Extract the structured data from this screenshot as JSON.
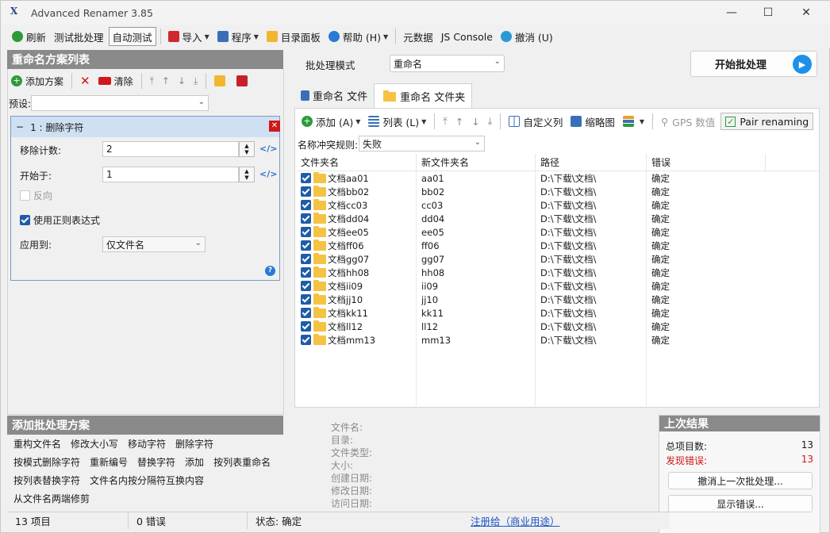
{
  "window": {
    "title": "Advanced Renamer 3.85"
  },
  "menu": [
    {
      "label": "刷新",
      "icon": "refresh-icon"
    },
    {
      "label": "测试批处理",
      "icon": ""
    },
    {
      "label": "自动测试",
      "icon": "",
      "active": true
    },
    {
      "label": "导入",
      "icon": "import-icon",
      "dropdown": true
    },
    {
      "label": "程序",
      "icon": "program-icon",
      "dropdown": true
    },
    {
      "label": "目录面板",
      "icon": "folder-icon"
    },
    {
      "label": "帮助 (H)",
      "icon": "help-icon",
      "dropdown": true
    },
    {
      "label": "元数据",
      "icon": ""
    },
    {
      "label": "JS Console",
      "icon": ""
    },
    {
      "label": "撤消 (U)",
      "icon": "undo-icon"
    }
  ],
  "left": {
    "header": "重命名方案列表",
    "add_method": "添加方案",
    "clear": "清除",
    "preset_label": "预设:",
    "rule": {
      "title": "1 : 删除字符",
      "fields": [
        {
          "label": "移除计数:",
          "value": "2"
        },
        {
          "label": "开始于:",
          "value": "1"
        }
      ],
      "reverse_label": "反向",
      "regex_label": "使用正则表达式",
      "apply_label": "应用到:",
      "apply_value": "仅文件名"
    }
  },
  "batch": {
    "mode_label": "批处理模式",
    "mode_value": "重命名",
    "start_button": "开始批处理"
  },
  "tabs": [
    {
      "label": "重命名 文件"
    },
    {
      "label": "重命名 文件夹"
    }
  ],
  "list_toolbar": {
    "add": "添加 (A)",
    "list": "列表 (L)",
    "custom_columns": "自定义列",
    "thumbnails": "缩略图",
    "gps": "GPS 数值",
    "pair_renaming": "Pair renaming"
  },
  "conflict": {
    "label": "名称冲突规则:",
    "value": "失败"
  },
  "columns": [
    "文件夹名",
    "新文件夹名",
    "路径",
    "错误"
  ],
  "rows": [
    {
      "name": "文档aa01",
      "new": "aa01",
      "path": "D:\\下载\\文档\\",
      "status": "确定"
    },
    {
      "name": "文档bb02",
      "new": "bb02",
      "path": "D:\\下载\\文档\\",
      "status": "确定"
    },
    {
      "name": "文档cc03",
      "new": "cc03",
      "path": "D:\\下载\\文档\\",
      "status": "确定"
    },
    {
      "name": "文档dd04",
      "new": "dd04",
      "path": "D:\\下载\\文档\\",
      "status": "确定"
    },
    {
      "name": "文档ee05",
      "new": "ee05",
      "path": "D:\\下载\\文档\\",
      "status": "确定"
    },
    {
      "name": "文档ff06",
      "new": "ff06",
      "path": "D:\\下载\\文档\\",
      "status": "确定"
    },
    {
      "name": "文档gg07",
      "new": "gg07",
      "path": "D:\\下载\\文档\\",
      "status": "确定"
    },
    {
      "name": "文档hh08",
      "new": "hh08",
      "path": "D:\\下载\\文档\\",
      "status": "确定"
    },
    {
      "name": "文档ii09",
      "new": "ii09",
      "path": "D:\\下载\\文档\\",
      "status": "确定"
    },
    {
      "name": "文档jj10",
      "new": "jj10",
      "path": "D:\\下载\\文档\\",
      "status": "确定"
    },
    {
      "name": "文档kk11",
      "new": "kk11",
      "path": "D:\\下载\\文档\\",
      "status": "确定"
    },
    {
      "name": "文档ll12",
      "new": "ll12",
      "path": "D:\\下载\\文档\\",
      "status": "确定"
    },
    {
      "name": "文档mm13",
      "new": "mm13",
      "path": "D:\\下载\\文档\\",
      "status": "确定"
    }
  ],
  "add_batch": {
    "header": "添加批处理方案",
    "lines": [
      [
        "重构文件名",
        "修改大小写",
        "移动字符",
        "删除字符"
      ],
      [
        "按模式删除字符",
        "重新编号",
        "替换字符",
        "添加",
        "按列表重命名"
      ],
      [
        "按列表替换字符",
        "文件名内按分隔符互换内容"
      ],
      [
        "从文件名两端修剪"
      ]
    ]
  },
  "info_labels": [
    "文件名:",
    "目录:",
    "文件类型:",
    "大小:",
    "创建日期:",
    "修改日期:",
    "访问日期:"
  ],
  "results": {
    "header": "上次结果",
    "total_label": "总项目数:",
    "total_value": "13",
    "errors_label": "发现错误:",
    "errors_value": "13",
    "undo_button": "撤消上一次批处理...",
    "show_errors_button": "显示错误..."
  },
  "status": {
    "items": "13 项目",
    "errors": "0 错误",
    "state": "状态: 确定",
    "register": "注册给（商业用途）"
  },
  "colors": {
    "accent": "#1f5ca8",
    "header_gray": "#8a8a8a",
    "error_red": "#d01818",
    "play_blue": "#1e90e8"
  }
}
